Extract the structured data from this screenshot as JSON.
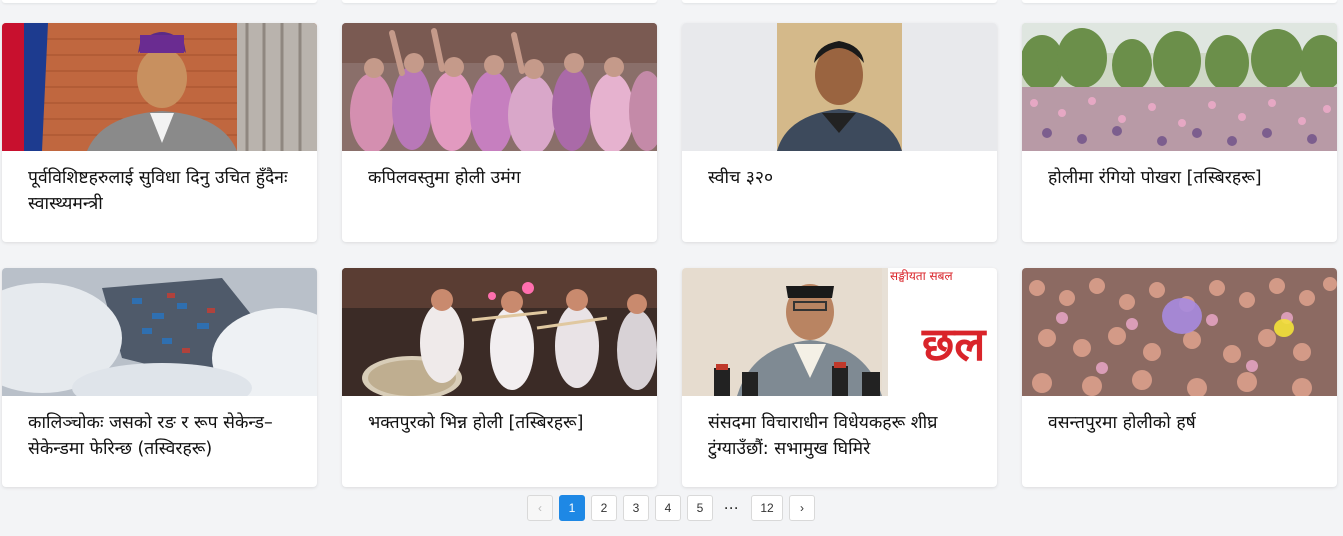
{
  "cards": [
    {
      "title": "पूर्वविशिष्टहरुलाई सुविधा दिनु उचित हुँदैनः स्वास्थ्यमन्त्री",
      "image": "health-minister-photo"
    },
    {
      "title": "कपिलवस्तुमा होली उमंग",
      "image": "kapilvastu-holi-crowd-photo"
    },
    {
      "title": "स्वीच ३२०",
      "image": "man-portrait-photo"
    },
    {
      "title": "होलीमा रंगियो पोखरा [तस्बिरहरू]",
      "image": "pokhara-holi-crowd-photo"
    },
    {
      "title": "कालिञ्चोकः जसको रङ र रूप सेकेन्ड–सेकेन्डमा फेरिन्छ (तस्विरहरू)",
      "image": "kalinchowk-clouds-aerial-photo"
    },
    {
      "title": "भक्तपुरको भिन्न होली [तस्बिरहरू]",
      "image": "bhaktapur-holi-musicians-photo"
    },
    {
      "title": "संसदमा विचाराधीन विधेयकहरू शीघ्र टुंग्याउँछौं: सभामुख घिमिरे",
      "image": "speaker-ghimire-press-photo"
    },
    {
      "title": "वसन्तपुरमा होलीको हर्ष",
      "image": "basantapur-holi-crowd-photo"
    }
  ],
  "pagination": {
    "prev": "‹",
    "pages": [
      "1",
      "2",
      "3",
      "4",
      "5"
    ],
    "ellipsis": "···",
    "last": "12",
    "next": "›",
    "current": "1"
  },
  "colors": {
    "accent": "#1e88e5",
    "background": "#f3f4f6",
    "card": "#ffffff"
  }
}
